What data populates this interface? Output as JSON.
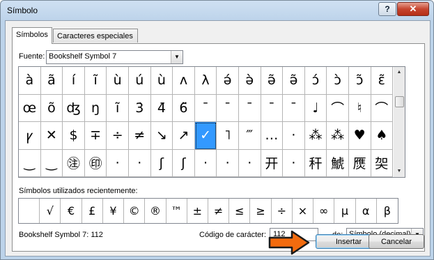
{
  "window": {
    "title": "Símbolo",
    "help_label": "?",
    "close_label": "✕"
  },
  "tabs": [
    {
      "label": "Símbolos",
      "active": true
    },
    {
      "label": "Caracteres especiales",
      "active": false
    }
  ],
  "font": {
    "label": "Fuente:",
    "value": "Bookshelf Symbol 7"
  },
  "grid_symbols": [
    "à",
    "ã",
    "í",
    "ĩ",
    "ù",
    "ú",
    "ù",
    "ʌ",
    "λ",
    "ə́",
    "ə̀",
    "ə̃",
    "ə̃",
    "ɔ́",
    "ɔ̀",
    "ɔ̃",
    "ɛ̃",
    "œ",
    "õ",
    "ʤ",
    "ŋ",
    "ı̃",
    "3̇",
    "4̄",
    "6̈",
    "ˉ",
    "ˉ",
    "ˉ",
    "ˉ",
    "ˉ",
    "♩",
    "⌒",
    "♮",
    "⌒",
    "ꝩ",
    "✕",
    "$",
    "∓",
    "÷",
    "≠",
    "↘",
    "↗",
    "✓",
    "˥",
    "‴",
    "…",
    "·",
    "⁂",
    "⁂",
    "♥",
    "♠",
    "‿",
    "‿",
    "㊟",
    "㊞",
    "·",
    "·",
    "ʃ",
    "ʃ",
    "·",
    "·",
    "·",
    "开",
    "·",
    "秆",
    "鯱",
    "㷳",
    "㚙"
  ],
  "selected_index": 42,
  "recent": {
    "label": "Símbolos utilizados recientemente:",
    "symbols": [
      "",
      "√",
      "€",
      "£",
      "¥",
      "©",
      "®",
      "™",
      "±",
      "≠",
      "≤",
      "≥",
      "÷",
      "×",
      "∞",
      "µ",
      "α",
      "β"
    ]
  },
  "status": {
    "description": "Bookshelf Symbol 7: 112"
  },
  "code": {
    "label": "Código de carácter:",
    "value": "112"
  },
  "from": {
    "label": "de:",
    "value": "Símbolo (decimal)"
  },
  "buttons": {
    "insert": "Insertar",
    "cancel": "Cancelar"
  },
  "colors": {
    "selection": "#3399ff",
    "arrow_fill": "#f26b0e",
    "arrow_stroke": "#1a1a1a"
  }
}
